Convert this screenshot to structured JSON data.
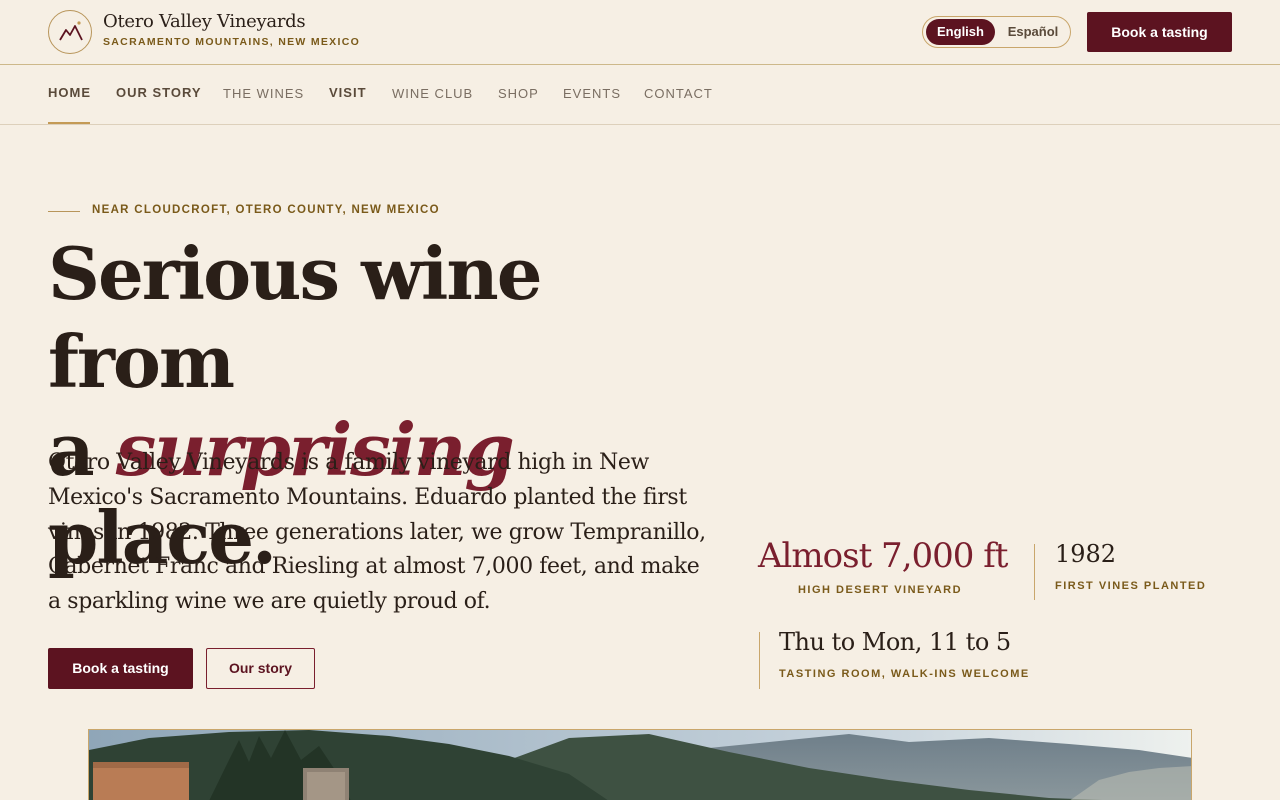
{
  "brand": {
    "name": "Otero Valley Vineyards",
    "tagline": "SACRAMENTO MOUNTAINS, NEW MEXICO",
    "logo_icon": "mountain-logo-icon"
  },
  "header": {
    "languages": [
      "English",
      "Español"
    ],
    "selected_language": "English",
    "book_label": "Book a tasting"
  },
  "nav": {
    "items": [
      "HOME",
      "OUR STORY",
      "THE WINES",
      "VISIT",
      "WINE CLUB",
      "SHOP",
      "EVENTS",
      "CONTACT"
    ],
    "active": "HOME"
  },
  "hero": {
    "eyebrow": "NEAR CLOUDCROFT, OTERO COUNTY, NEW MEXICO",
    "headline_part1": "Serious wine from",
    "headline_part2": "a ",
    "headline_accent": "surprising",
    "headline_part3": " place.",
    "lede": "Otero Valley Vineyards is a family vineyard high in New Mexico's Sacramento Mountains. Eduardo planted the first vines in 1982. Three generations later, we grow Tempranillo, Cabernet Franc and Riesling at almost 7,000 feet, and make a sparkling wine we are quietly proud of.",
    "primary_cta": "Book a tasting",
    "secondary_cta": "Our story"
  },
  "stats": {
    "elevation_value": "Almost 7,000 ft",
    "elevation_label": "HIGH DESERT VINEYARD",
    "year_value": "1982",
    "year_label": "FIRST VINES PLANTED",
    "hours_value": "Thu to Mon, 11 to 5",
    "hours_label": "TASTING ROOM, WALK-INS WELCOME"
  },
  "colors": {
    "background": "#f6efe4",
    "brand_wine": "#5c1320",
    "accent_wine": "#7a1f2e",
    "gold": "#c9a66b",
    "ink": "#2a1f18"
  }
}
